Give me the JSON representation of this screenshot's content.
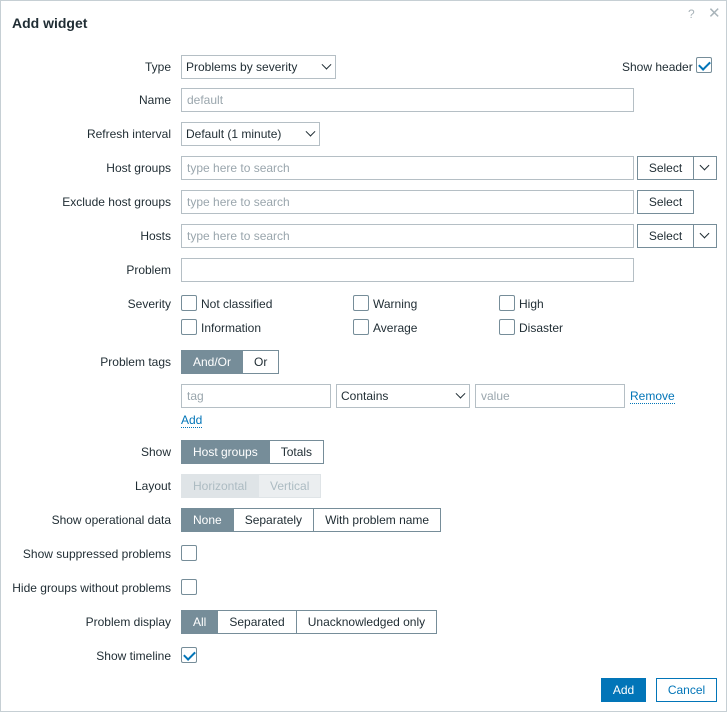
{
  "dialog": {
    "title": "Add widget"
  },
  "header_icons": {
    "help": "?",
    "close": "✕"
  },
  "form": {
    "type": {
      "label": "Type",
      "value": "Problems by severity"
    },
    "show_header": {
      "label": "Show header",
      "checked": true
    },
    "name": {
      "label": "Name",
      "placeholder": "default"
    },
    "refresh_interval": {
      "label": "Refresh interval",
      "value": "Default (1 minute)"
    },
    "host_groups": {
      "label": "Host groups",
      "placeholder": "type here to search",
      "select_label": "Select"
    },
    "exclude_host_groups": {
      "label": "Exclude host groups",
      "placeholder": "type here to search",
      "select_label": "Select"
    },
    "hosts": {
      "label": "Hosts",
      "placeholder": "type here to search",
      "select_label": "Select"
    },
    "problem": {
      "label": "Problem",
      "value": ""
    },
    "severity": {
      "label": "Severity",
      "options": [
        {
          "label": "Not classified",
          "checked": false
        },
        {
          "label": "Warning",
          "checked": false
        },
        {
          "label": "High",
          "checked": false
        },
        {
          "label": "Information",
          "checked": false
        },
        {
          "label": "Average",
          "checked": false
        },
        {
          "label": "Disaster",
          "checked": false
        }
      ]
    },
    "problem_tags": {
      "label": "Problem tags",
      "options": [
        "And/Or",
        "Or"
      ],
      "selected": "And/Or",
      "tag_placeholder": "tag",
      "operator": "Contains",
      "value_placeholder": "value",
      "remove_label": "Remove",
      "add_label": "Add"
    },
    "show": {
      "label": "Show",
      "options": [
        "Host groups",
        "Totals"
      ],
      "selected": "Host groups"
    },
    "layout": {
      "label": "Layout",
      "options": [
        "Horizontal",
        "Vertical"
      ],
      "selected": "Horizontal",
      "disabled": true
    },
    "show_operational_data": {
      "label": "Show operational data",
      "options": [
        "None",
        "Separately",
        "With problem name"
      ],
      "selected": "None"
    },
    "show_suppressed": {
      "label": "Show suppressed problems",
      "checked": false
    },
    "hide_groups": {
      "label": "Hide groups without problems",
      "checked": false
    },
    "problem_display": {
      "label": "Problem display",
      "options": [
        "All",
        "Separated",
        "Unacknowledged only"
      ],
      "selected": "All"
    },
    "show_timeline": {
      "label": "Show timeline",
      "checked": true
    }
  },
  "footer": {
    "add_label": "Add",
    "cancel_label": "Cancel"
  },
  "colors": {
    "primary": "#0275b8",
    "segment_active": "#768d99",
    "border": "#b5bfc5"
  }
}
